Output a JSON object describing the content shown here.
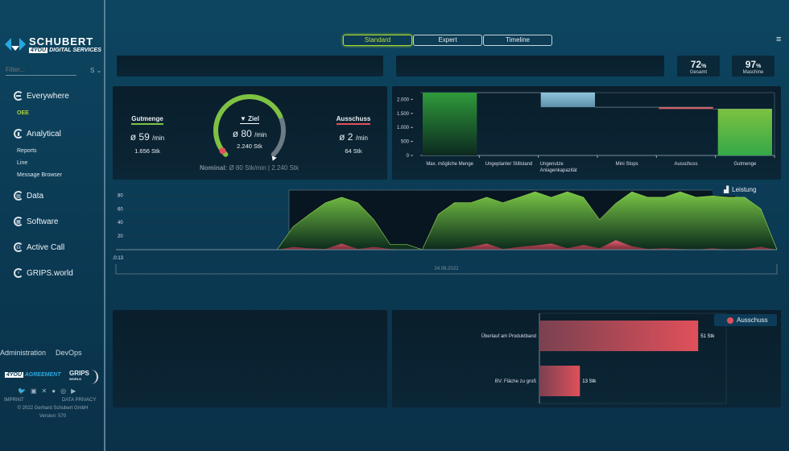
{
  "brand": {
    "name": "SCHUBERT",
    "tag_badge": "4YOU",
    "tag": "DIGITAL SERVICES"
  },
  "sidebar": {
    "filter_placeholder": "Filter...",
    "filter_select": "S",
    "items": [
      {
        "label": "Everywhere",
        "icon": "everywhere-icon",
        "sub": [
          {
            "label": "OEE",
            "active": true
          }
        ]
      },
      {
        "label": "Analytical",
        "icon": "analytical-icon",
        "sub": [
          {
            "label": "Reports"
          },
          {
            "label": "Line"
          },
          {
            "label": "Message Browser"
          }
        ]
      },
      {
        "label": "Data",
        "icon": "data-icon",
        "sub": []
      },
      {
        "label": "Software",
        "icon": "software-icon",
        "sub": []
      },
      {
        "label": "Active Call",
        "icon": "active-call-icon",
        "sub": []
      },
      {
        "label": "GRIPS.world",
        "icon": "grips-icon",
        "sub": []
      }
    ],
    "footer": {
      "administration": "Administration",
      "devops": "DevOps",
      "agreement_badge": "4YOU",
      "agreement": "AGREEMENT",
      "grips": "GRIPS",
      "grips_sub": "WORLD",
      "imprint": "IMPRINT",
      "privacy": "DATA PRIVACY",
      "copyright": "© 2022 Gerhard Schubert GmbH",
      "version": "Version: 570"
    }
  },
  "tabs": [
    {
      "label": "Standard",
      "active": true
    },
    {
      "label": "Expert"
    },
    {
      "label": "Timeline"
    }
  ],
  "kpis": [
    {
      "value": "72",
      "unit": "%",
      "label": "Gesamt"
    },
    {
      "value": "97",
      "unit": "%",
      "label": "Maschine"
    }
  ],
  "gauge": {
    "gut": {
      "title": "Gutmenge",
      "rate": "ø 59",
      "rate_unit": "/min",
      "count": "1.656 Stk"
    },
    "ziel": {
      "title": "Ziel",
      "rate": "ø 80",
      "rate_unit": "/min",
      "count": "2.240 Stk"
    },
    "aus": {
      "title": "Ausschuss",
      "rate": "ø 2",
      "rate_unit": "/min",
      "count": "64 Stk"
    },
    "nominal_label": "Nominal:",
    "nominal_value": "Ø 80 Stk/min | 2.240 Stk",
    "fill_fraction": 0.74,
    "colors": {
      "good": "#7ec242",
      "scrap": "#e0505a",
      "track": "#6d7b84"
    }
  },
  "chart_data": [
    {
      "type": "bar",
      "subtype": "waterfall",
      "categories": [
        "Max. mögliche Menge",
        "Ungeplanter Stillstand",
        "Ungenutze Anlagenkapazität",
        "Mini Stops",
        "Ausschuss",
        "Gutmenge"
      ],
      "values": [
        2240,
        0,
        -520,
        0,
        -64,
        1656
      ],
      "yticks": [
        "0",
        "500",
        "1.000",
        "1.500",
        "2.000"
      ],
      "ylim": [
        0,
        2240
      ]
    },
    {
      "type": "area",
      "series": [
        {
          "name": "Leistung",
          "color": "#6fc23f",
          "values": [
            0,
            0,
            0,
            0,
            0,
            0,
            0,
            0,
            0,
            0,
            0,
            34,
            52,
            69,
            77,
            69,
            44,
            8,
            8,
            0,
            52,
            69,
            69,
            77,
            69,
            77,
            85,
            77,
            85,
            77,
            44,
            68,
            85,
            77,
            77,
            85,
            77,
            79,
            77,
            77,
            60,
            0
          ]
        },
        {
          "color": "#e0505a",
          "values": [
            0,
            0,
            0,
            0,
            0,
            0,
            0,
            0,
            0,
            0,
            0,
            4,
            2,
            1,
            9,
            1,
            4,
            1,
            0,
            0,
            0,
            1,
            4,
            9,
            1,
            4,
            6,
            9,
            2,
            7,
            2,
            14,
            5,
            1,
            2,
            1,
            0,
            2,
            0,
            1,
            4,
            0
          ]
        }
      ],
      "yticks": [
        "20",
        "40",
        "60",
        "80"
      ],
      "ylim": [
        0,
        90
      ],
      "x_start_label": "10:13",
      "date_label": "24.08.2022"
    },
    {
      "type": "bar",
      "orientation": "horizontal",
      "categories": [
        "Überlauf am Produktband",
        "BV: Fläche zu groß"
      ],
      "values": [
        51,
        13
      ],
      "labels": [
        "51 Stk",
        "13 Stk"
      ],
      "legend": "Ausschuss",
      "color": "#e0505a",
      "xlim": [
        0,
        60
      ]
    }
  ]
}
